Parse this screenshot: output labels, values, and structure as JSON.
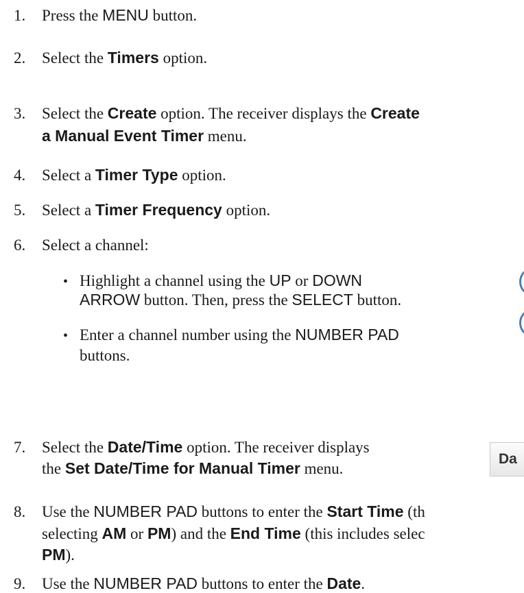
{
  "steps": [
    {
      "num": "1.",
      "parts": [
        {
          "t": "Press the "
        },
        {
          "t": "MENU",
          "s": "sans"
        },
        {
          "t": " button."
        }
      ]
    },
    {
      "num": "2.",
      "parts": [
        {
          "t": "Select the "
        },
        {
          "t": "Timers",
          "s": "b"
        },
        {
          "t": " option."
        }
      ]
    },
    {
      "num": "3.",
      "lines": [
        [
          {
            "t": "Select the "
          },
          {
            "t": "Create",
            "s": "b"
          },
          {
            "t": " option. The receiver displays the "
          },
          {
            "t": "Create",
            "s": "b"
          }
        ],
        [
          {
            "t": "a Manual Event Timer",
            "s": "b"
          },
          {
            "t": " menu."
          }
        ]
      ]
    },
    {
      "num": "4.",
      "parts": [
        {
          "t": "Select a "
        },
        {
          "t": "Timer Type",
          "s": "b"
        },
        {
          "t": " option."
        }
      ]
    },
    {
      "num": "5.",
      "parts": [
        {
          "t": "Select a "
        },
        {
          "t": "Timer Frequency",
          "s": "b"
        },
        {
          "t": " option."
        }
      ]
    },
    {
      "num": "6.",
      "parts": [
        {
          "t": "Select a channel:"
        }
      ]
    },
    {
      "num": "7.",
      "lines": [
        [
          {
            "t": "Select the "
          },
          {
            "t": "Date/Time",
            "s": "b"
          },
          {
            "t": " option. The receiver displays"
          }
        ],
        [
          {
            "t": "the "
          },
          {
            "t": "Set Date/Time for Manual Timer",
            "s": "b"
          },
          {
            "t": " menu."
          }
        ]
      ]
    },
    {
      "num": "8.",
      "lines": [
        [
          {
            "t": "Use the "
          },
          {
            "t": "NUMBER PAD",
            "s": "sans"
          },
          {
            "t": " buttons to enter the "
          },
          {
            "t": "Start Time",
            "s": "b"
          },
          {
            "t": " (th"
          }
        ],
        [
          {
            "t": "selecting "
          },
          {
            "t": "AM",
            "s": "b"
          },
          {
            "t": " or "
          },
          {
            "t": "PM",
            "s": "b"
          },
          {
            "t": ") and the "
          },
          {
            "t": "End Time",
            "s": "b"
          },
          {
            "t": " (this includes selec"
          }
        ],
        [
          {
            "t": "PM",
            "s": "b"
          },
          {
            "t": ")."
          }
        ]
      ]
    },
    {
      "num": "9.",
      "parts": [
        {
          "t": "Use the "
        },
        {
          "t": "NUMBER PAD",
          "s": "sans"
        },
        {
          "t": " buttons to enter the "
        },
        {
          "t": "Date",
          "s": "b"
        },
        {
          "t": "."
        }
      ]
    }
  ],
  "bullets": [
    {
      "symbol": "•",
      "lines": [
        [
          {
            "t": "Highlight a channel using the "
          },
          {
            "t": "UP",
            "s": "sans"
          },
          {
            "t": " or "
          },
          {
            "t": "DOWN",
            "s": "sans"
          }
        ],
        [
          {
            "t": "ARROW",
            "s": "sans"
          },
          {
            "t": " button. Then, press the "
          },
          {
            "t": "SELECT",
            "s": "sans"
          },
          {
            "t": " button."
          }
        ]
      ]
    },
    {
      "symbol": "•",
      "lines": [
        [
          {
            "t": "Enter a channel number using the "
          },
          {
            "t": "NUMBER PAD",
            "s": "sans"
          }
        ],
        [
          {
            "t": "buttons."
          }
        ]
      ]
    }
  ],
  "side_button": {
    "label": "Da",
    "icon": "date-time-button-partial"
  },
  "side_glyphs": [
    "channel-selector-icon-partial",
    "channel-selector-icon-partial"
  ]
}
